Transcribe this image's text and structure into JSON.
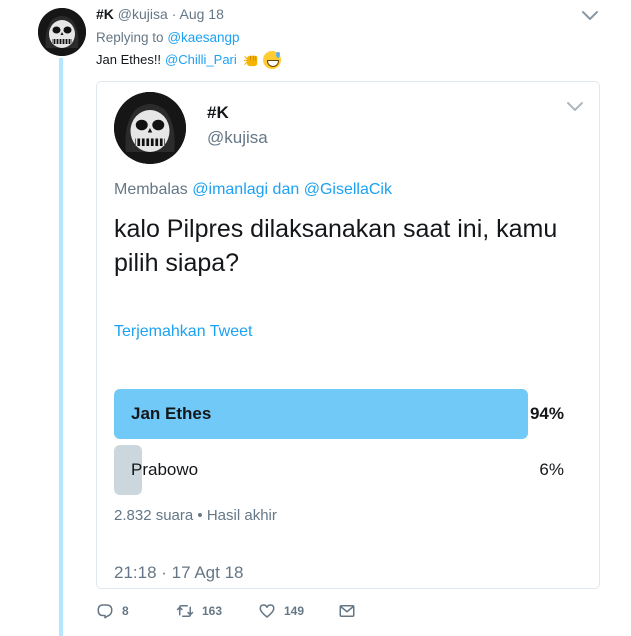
{
  "tweet": {
    "author_name": "#K",
    "author_handle": "@kujisa",
    "separator": "·",
    "date": "Aug 18",
    "replying_label": "Replying to",
    "replying_to": "@kaesangp",
    "text": "Jan Ethes!!",
    "mention": "@Chilli_Pari",
    "emoji": [
      "oncoming-fist",
      "grinning-face-with-sweat"
    ]
  },
  "quoted": {
    "author_name": "#K",
    "author_handle": "@kujisa",
    "replying_label": "Membalas",
    "replying_to_1": "@imanlagi",
    "replying_conj": "dan",
    "replying_to_2": "@GisellaCik",
    "text": "kalo Pilpres dilaksanakan saat ini, kamu pilih siapa?",
    "translate_link": "Terjemahkan Tweet",
    "poll": {
      "options": [
        {
          "label": "Jan Ethes",
          "percent_label": "94%",
          "percent": 94
        },
        {
          "label": "Prabowo",
          "percent_label": "6%",
          "percent": 6
        }
      ],
      "votes": "2.832 suara",
      "meta_separator": "•",
      "status": "Hasil akhir"
    },
    "timestamp": "21:18 · 17 Agt 18"
  },
  "actions": {
    "reply_count": "8",
    "retweet_count": "163",
    "like_count": "149"
  },
  "colors": {
    "accent": "#1da1f2",
    "poll_winner": "#71c9f8",
    "poll_other": "#ccd6dd",
    "thread_line": "#b4e7ff",
    "muted_text": "#657786"
  },
  "icons": [
    "chevron-down-icon",
    "reply-icon",
    "retweet-icon",
    "heart-icon",
    "envelope-icon"
  ]
}
